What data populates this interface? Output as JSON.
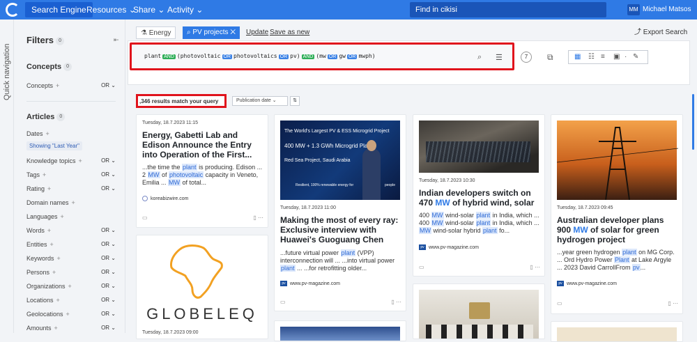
{
  "topbar": {
    "active_tab": "Search Engine",
    "nav": [
      "Resources",
      "Share",
      "Activity"
    ],
    "find_placeholder": "Find in cikisi",
    "avatar_initials": "MM",
    "user_name": "Michael Matsos"
  },
  "quicknav": {
    "label": "Quick navigation"
  },
  "filters": {
    "title": "Filters",
    "count": "0",
    "concepts_title": "Concepts",
    "concepts_count": "0",
    "concepts_row": "Concepts",
    "articles_title": "Articles",
    "articles_count": "0",
    "dates_label": "Dates",
    "showing": "Showing \"Last Year\"",
    "rows": [
      "Knowledge topics",
      "Tags",
      "Rating",
      "Domain names",
      "Languages",
      "Words",
      "Entities",
      "Keywords",
      "Persons",
      "Organizations",
      "Locations",
      "Geolocations",
      "Amounts"
    ],
    "or_label": "OR"
  },
  "breadcrumb": {
    "item1": "Energy",
    "item2": "PV projects",
    "update": "Update",
    "save_as_new": "Save as new",
    "export": "Export Search"
  },
  "query": {
    "t1": "plant",
    "and1": "AND",
    "t2": "(photovoltaic",
    "or1": "OR",
    "t3": "photovoltaics",
    "or2": "OR",
    "t4": "pv)",
    "and2": "AND",
    "t5": "(mw",
    "or3": "OR",
    "t6": "gw",
    "or4": "OR",
    "t7": "mwph)",
    "count": "7"
  },
  "results": {
    "count_text": ",346 results match your query",
    "sort": "Publication date"
  },
  "cards": [
    {
      "date": "Tuesday, 18.7.2023 11:15",
      "title": "Energy, Gabetti Lab and Edison Announce the Entry into Operation of the First...",
      "s1": "...the time the ",
      "h1": "plant",
      "s2": " is producing. Edison ... 2 ",
      "h2": "MW",
      "s3": " of ",
      "h3": "photovoltaic",
      "s4": " capacity in Veneto, Emilia ... ",
      "h4": "MW",
      "s5": " of total...",
      "source": "koreabizwire.com"
    },
    {
      "img_line1": "The World's Largest PV & ESS Microgrid Project",
      "img_line2": "400 MW + 1.3 GWh Microgrid Plan",
      "img_line3": "Red Sea Project, Saudi Arabia",
      "img_line4": "Resilient, 100% renewable energy for",
      "img_line5": "people",
      "date": "Tuesday, 18.7.2023 11:00",
      "title": "Making the most of every ray: Exclusive interview with Huawei's Guoguang Chen",
      "s1": "...future virtual power ",
      "h1": "plant",
      "s2": " (VPP) interconnection will ... ...into virtual power ",
      "h2": "plant",
      "s3": " ... ...for retrofitting older...",
      "source": "www.pv-magazine.com"
    },
    {
      "date": "Tuesday, 18.7.2023 10:30",
      "title_a": "Indian developers switch on 470 ",
      "title_hl": "MW",
      "title_b": " of hybrid wind, solar",
      "s1": "400 ",
      "h1": "MW",
      "s2": " wind-solar ",
      "h2": "plant",
      "s3": " in India, which ... 400 ",
      "h3": "MW",
      "s4": " wind-solar ",
      "h4": "plant",
      "s5": " in India, which ... ",
      "h5": "MW",
      "s6": " wind-solar hybrid ",
      "h6": "plant",
      "s7": " fo...",
      "source": "www.pv-magazine.com"
    },
    {
      "date": "Tuesday, 18.7.2023 09:45",
      "title_a": "Australian developer plans 900 ",
      "title_hl": "MW",
      "title_b": " of solar for green hydrogen project",
      "s1": "...year green hydrogen ",
      "h1": "plant",
      "s2": " on MG Corp. ... Ord Hydro Power ",
      "h2": "Plant",
      "s3": " at Lake Argyle ... 2023 David CarrollFrom ",
      "h3": "pv",
      "s4": "...",
      "source": "www.pv-magazine.com"
    },
    {
      "logo_text": "GLOBELEQ",
      "date": "Tuesday, 18.7.2023 09:00"
    }
  ],
  "colors": {
    "accent": "#2f7ae5",
    "highlight_box": "#e0131c",
    "and_op": "#2eae58",
    "or_op": "#3b82e6"
  }
}
